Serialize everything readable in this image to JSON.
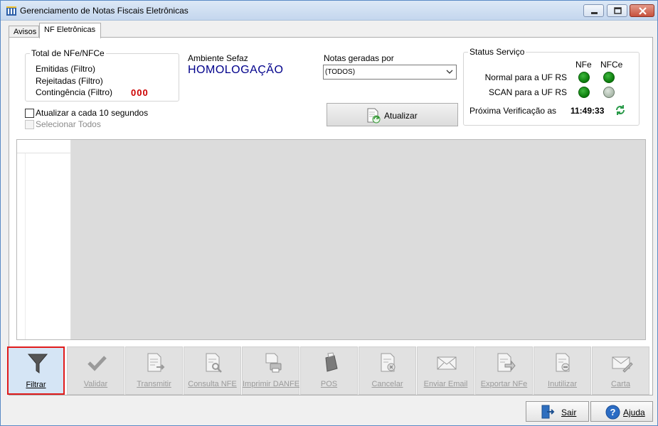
{
  "window": {
    "title": "Gerenciamento de Notas Fiscais Eletrônicas"
  },
  "tabs": [
    {
      "label": "Avisos",
      "active": false
    },
    {
      "label": "NF Eletrônicas",
      "active": true
    }
  ],
  "total_group": {
    "title": "Total de NFe/NFCe",
    "emitidas": "Emitidas (Filtro)",
    "rejeitadas": "Rejeitadas (Filtro)",
    "contingencia": "Contingência (Filtro)",
    "contingencia_count": "000"
  },
  "ambiente": {
    "label": "Ambiente Sefaz",
    "value": "HOMOLOGAÇÃO"
  },
  "notas_geradas": {
    "label": "Notas geradas por",
    "selected": "(TODOS)"
  },
  "atualizar_button": {
    "label": "Atualizar"
  },
  "checkboxes": {
    "auto_refresh": {
      "label": "Atualizar a cada 10 segundos",
      "checked": false
    },
    "select_all": {
      "label": "Selecionar Todos",
      "checked": false,
      "enabled": false
    }
  },
  "status_servico": {
    "title": "Status Serviço",
    "col_nfe": "NFe",
    "col_nfce": "NFCe",
    "normal_label": "Normal para a UF RS",
    "scan_label": "SCAN para a UF RS",
    "normal": {
      "nfe": "online",
      "nfce": "online"
    },
    "scan": {
      "nfe": "online",
      "nfce": "offline"
    },
    "proxima_label": "Próxima Verificação as",
    "proxima_time": "11:49:33"
  },
  "colors": {
    "online": "#0a7a0a",
    "offline": "#a9b8a9",
    "counter": "#cc0000",
    "ambiente": "#00008b",
    "highlight": "#e01b1b"
  },
  "toolbar": [
    {
      "label": "Filtrar",
      "icon": "funnel-icon",
      "enabled": true,
      "highlighted": true
    },
    {
      "label": "Validar",
      "icon": "checkmark-icon",
      "enabled": false
    },
    {
      "label": "Transmitir",
      "icon": "document-send-icon",
      "enabled": false
    },
    {
      "label": "Consulta NFE",
      "icon": "document-search-icon",
      "enabled": false
    },
    {
      "label": "Imprimir DANFE",
      "icon": "printer-icon",
      "enabled": false
    },
    {
      "label": "POS",
      "icon": "pos-terminal-icon",
      "enabled": false
    },
    {
      "label": "Cancelar",
      "icon": "document-cancel-icon",
      "enabled": false
    },
    {
      "label": "Enviar Email",
      "icon": "envelope-icon",
      "enabled": false
    },
    {
      "label": "Exportar NFe",
      "icon": "document-export-icon",
      "enabled": false
    },
    {
      "label": "Inutilizar",
      "icon": "document-block-icon",
      "enabled": false
    },
    {
      "label": "Carta",
      "icon": "letter-pen-icon",
      "enabled": false
    }
  ],
  "footer": {
    "sair_label": "Sair",
    "ajuda_label": "Ajuda"
  }
}
